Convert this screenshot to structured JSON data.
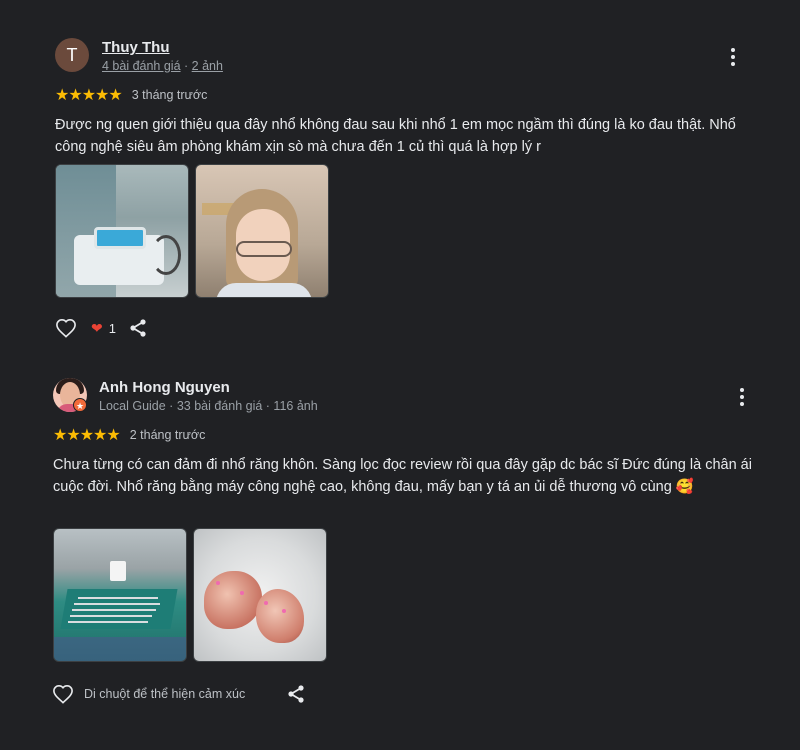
{
  "reviews": [
    {
      "avatar_letter": "T",
      "name": "Thuy Thu",
      "meta": {
        "reviews_link": "4 bài đánh giá",
        "sep": " · ",
        "photos_link": "2 ảnh"
      },
      "stars": "★★★★★",
      "time": "3 tháng trước",
      "text": "Được ng quen giới thiệu qua đây nhổ không đau sau khi nhổ 1 em mọc ngầm thì đúng là ko đau thật. Nhổ công nghệ siêu âm phòng khám xịn sò mà chưa đến 1 củ thì quá là hợp lý r",
      "reaction_count": "1"
    },
    {
      "name": "Anh Hong Nguyen",
      "badge_glyph": "★",
      "meta": "Local Guide · 33 bài đánh giá · 116 ảnh",
      "stars": "★★★★★",
      "time": "2 tháng trước",
      "text": "Chưa từng có can đảm đi nhổ răng khôn. Sàng lọc đọc review rồi qua đây gặp dc bác sĩ Đức đúng là chân ái cuộc đời. Nhổ răng bằng máy công nghệ cao, không đau, mấy bạn y tá an ủi dễ thương vô cùng 🥰",
      "react_hint": "Di chuột để thể hiện cảm xúc"
    }
  ],
  "colors": {
    "background": "#202124",
    "star": "#fbbc04",
    "heart": "#ea4335"
  }
}
